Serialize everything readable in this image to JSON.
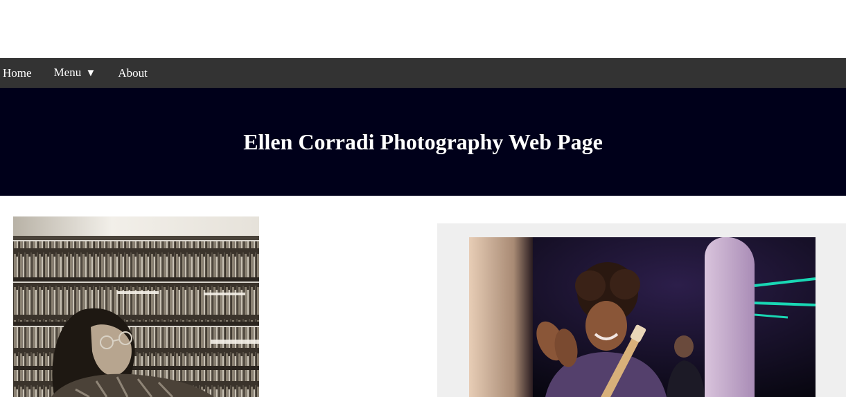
{
  "nav": {
    "home_label": "Home",
    "menu_label": "Menu",
    "menu_caret": "▼",
    "about_label": "About"
  },
  "banner": {
    "title": "Ellen Corradi Photography Web Page"
  },
  "colors": {
    "navbar": "#333333",
    "banner": "#00001a",
    "panel": "#efefef",
    "nav_text": "#ffffff"
  },
  "gallery": {
    "left_photo_icon": "photo-library-portrait",
    "right_photo_icon": "photo-guitarist-concert"
  }
}
